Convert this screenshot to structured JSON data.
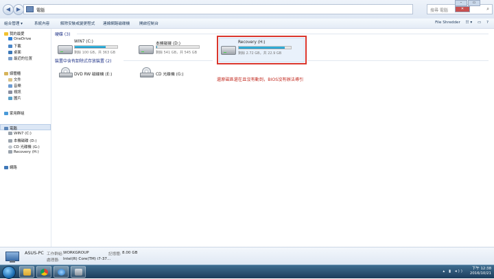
{
  "address": {
    "path": "電腦",
    "search_placeholder": "搜尋 電腦"
  },
  "toolbar": {
    "items": [
      "組合管理 ▾",
      "系統內容",
      "解除安裝或變更程式",
      "連線網路磁碟機",
      "開啟控制台"
    ],
    "right": "File Shredder"
  },
  "sidebar": {
    "favorites": "我的最愛",
    "fav_items": [
      "OneDrive",
      "下載",
      "桌面",
      "最近的位置"
    ],
    "libraries": "媒體櫃",
    "lib_items": [
      "文件",
      "音樂",
      "視訊",
      "圖片"
    ],
    "homegroup": "家用群組",
    "computer": "電腦",
    "comp_items": [
      "WIN7 (C:)",
      "本機磁碟 (D:)",
      "CD 光碟機 (G:)",
      "Recovery (H:)"
    ],
    "network": "網路"
  },
  "hard_disks": {
    "header": "硬碟 (3)",
    "drives": [
      {
        "name": "WIN7 (C:)",
        "free": "剩餘 100 GB，共 363 GB",
        "used_fraction": 0.72
      },
      {
        "name": "本機磁碟 (D:)",
        "free": "剩餘 541 GB，共 545 GB",
        "used_fraction": 0.01
      },
      {
        "name": "Recovery (H:)",
        "free": "剩餘 2.72 GB，共 22.9 GB",
        "used_fraction": 0.88
      }
    ]
  },
  "removable": {
    "header": "裝置中含有卸除式存放裝置 (2)",
    "devices": [
      {
        "name": "DVD RW 磁碟機 (E:)"
      },
      {
        "name": "CD 光碟機 (G:)"
      }
    ]
  },
  "annotation": "還原磁區還在且沒有動到，BIOS沒有辦法導引",
  "details": {
    "pc_name": "ASUS-PC",
    "workgroup_label": "工作群組:",
    "workgroup": "WORKGROUP",
    "memory_label": "記憶體:",
    "memory": "8.00 GB",
    "processor_label": "處理器:",
    "processor": "Intel(R) Core(TM) i7-37..."
  },
  "taskbar": {
    "time": "下午 12:38",
    "date": "2016/10/21"
  },
  "colors": {
    "bar_fill": "#1b8fc0",
    "highlight": "#d9342b",
    "annotation": "#c22a1f"
  }
}
